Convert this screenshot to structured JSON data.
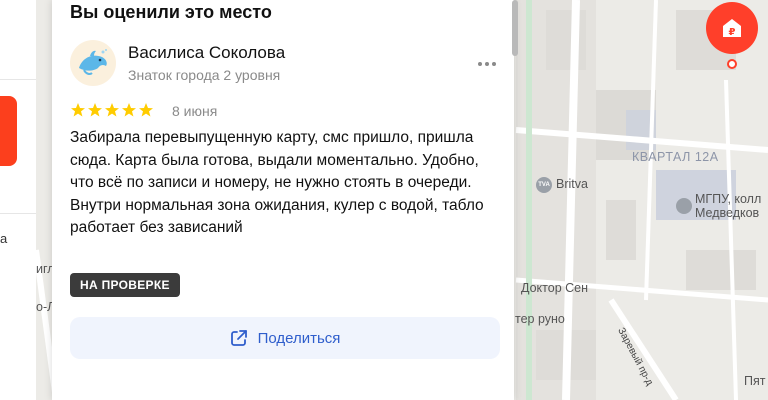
{
  "panel": {
    "title": "Вы оценили это место"
  },
  "review": {
    "user_name": "Василиса Соколова",
    "user_level": "Знаток города 2 уровня",
    "rating": 5,
    "date": "8 июня",
    "text": "Забирала перевыпущенную карту, смс пришло, пришла сюда. Карта была готова, выдали моментально. Удобно, что всё по записи и номеру, не нужно стоять в очереди. Внутри нормальная зона ожидания, кулер с водой, табло работает без зависаний",
    "status": "НА ПРОВЕРКЕ",
    "share_label": "Поделиться"
  },
  "left_fragment": "а",
  "map": {
    "labels": {
      "kvartal": "КВАРТАЛ 12А",
      "britva": "Britva",
      "mgpu_1": "МГПУ, колл",
      "mgpu_2": "Медведков",
      "doktor": "Доктор Сен",
      "runo": "тер руно",
      "street": "Заревый пр-д",
      "pyat": "Пят",
      "frag_gl": "игл",
      "frag_l": "о-Л",
      "tva": "TVA"
    },
    "pin_symbol": "₽"
  },
  "colors": {
    "accent_red": "#fc3f1d",
    "star": "#ffcc00",
    "link_blue": "#2f5ecc",
    "share_bg": "#f0f4fd",
    "badge_bg": "#3b3b3b"
  }
}
